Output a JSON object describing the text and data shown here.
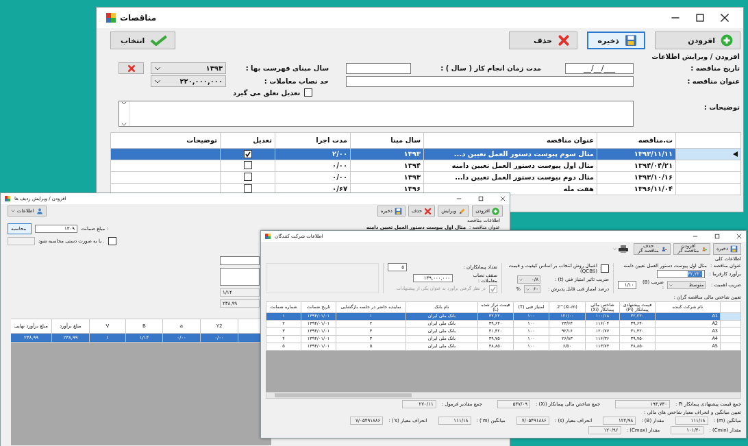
{
  "main_window": {
    "title": "مناقصات",
    "toolbar": [
      {
        "label": "افزودن",
        "focused": false
      },
      {
        "label": "ذخیره",
        "focused": true
      },
      {
        "label": "حذف",
        "focused": false
      }
    ],
    "select_button": {
      "label": "انتخاب"
    },
    "form": {
      "title": "افزودن / ویرایش اطلاعات",
      "date_label": "تاریخ مناقصه :",
      "date_value": "___/__/__",
      "duration_label": "مدت زمان انجام کار ( سال ) :",
      "base_year_label": "سال مبنای فهرست بها :",
      "base_year": "۱۳۹۳",
      "title_label": "عنوان مناقصه :",
      "threshold_label": "حد نصاب معاملات :",
      "threshold": "۲۲۰,۰۰۰,۰۰۰",
      "adjustment": {
        "label": "تعدیل تعلق می گیرد",
        "checked": false
      },
      "notes_label": "توضیحات :"
    },
    "table": {
      "columns": [
        "ت.مناقصه",
        "عنوان مناقصه",
        "سال مبنا",
        "مدت اجرا",
        "تعدیل",
        "توضیحات"
      ],
      "rows": [
        {
          "date": "۱۳۹۳/۱۱/۱۱",
          "title": "مثال سوم پیوست دستور العمل تعیین د...",
          "year": "۱۳۹۳",
          "duration": "۲/۰۰",
          "adjusted": true,
          "selected": true
        },
        {
          "date": "۱۳۹۴/۰۴/۲۱",
          "title": "مثال اول پیوست دستور العمل تعیین دامنه",
          "year": "۱۳۹۴",
          "duration": "۰/۰۰",
          "adjusted": false,
          "selected": false
        },
        {
          "date": "۱۳۹۳/۱۰/۱۶",
          "title": "مثال دوم پیوست دستور العمل تعیین دا...",
          "year": "۱۳۹۳",
          "duration": "۰/۰۰",
          "adjusted": false,
          "selected": false
        },
        {
          "date": "۱۳۹۶/۱۱/۰۴",
          "title": "هفت مله",
          "year": "۱۳۹۶",
          "duration": "۰/۶۷",
          "adjusted": false,
          "selected": false
        }
      ]
    }
  },
  "rows_window": {
    "title": "افزودن / ویرایش ردیف ها",
    "info_button": "اطلاعات",
    "toolbar": [
      {
        "label": "افزودن"
      },
      {
        "label": "ویرایش"
      },
      {
        "label": "حذف"
      },
      {
        "label": "ذخیره"
      }
    ],
    "tender_info": {
      "title": "اطلاعات مناقصه",
      "label": "عنوان مناقصه :",
      "value": "مثال اول پیوست دستور العمل تعیین دامنه"
    },
    "guarantee_label": "مبلغ ضمانت :",
    "guarantee_value": "۱۳۰۹",
    "calc_button": "محاسبه",
    "manual": {
      "label": "یا به صورت دستی محاسبه شود .",
      "checked": false
    },
    "readouts": [
      "۱/۱۴",
      "۲۳۸,۹۹"
    ],
    "table": {
      "columns": [
        "Y2",
        "a",
        "B",
        "V",
        "مبلغ برآورد",
        "مبلغ برآورد نهایی"
      ],
      "rows": [
        {
          "cells": [
            "۰/۰۰",
            "۰/۰۰",
            "۱/۱۴",
            "۱",
            "۲۳۸,۹۹",
            "۲۳۸,۹۹"
          ],
          "selected": true
        }
      ]
    }
  },
  "bidders_window": {
    "title": "اطلاعات شرکت کنندگان",
    "toolbar": [
      {
        "label": "ذخیره"
      },
      {
        "label": "افزودن مناقصه گر"
      },
      {
        "label": "حذف مناقصه گر"
      }
    ],
    "general": {
      "title": "اطلاعات کلی",
      "tender_label": "عنوان مناقصه :",
      "tender_value": "مثال اول پیوست دستور العمل تعیین دامنه",
      "estimate_label": "برآورد کارفرما :",
      "estimate_value": "۳۲,۲۲۰",
      "importance_label": "ضریب اهمیت :",
      "importance": "متوسط",
      "b_label": "ضریب (B) :",
      "b_value": "۱/۱۰",
      "qcbs": {
        "label": "اعمال روش انتخاب بر اساس کیفیت و قیمت (QCBS)",
        "checked": false
      },
      "t_label": "ضریب تاثیر امتیاز فنی (t) :",
      "t_value": "۰/۸",
      "pass_label": "درصد امتیاز فنی قابل پذیرش :",
      "pass_value": "۶۰",
      "percent": "%",
      "count_label": "تعداد پیمانکاران :",
      "count": "۵",
      "cap_label": "سقف نصاب معاملات :",
      "cap": "۱۳۹,۰۰۰,۰۰۰",
      "include_estimate": {
        "label": "در نظر گرفتن برآورد به عنوان یکی از پیشنهادات",
        "checked": true,
        "disabled": true
      }
    },
    "table_title": "تعیین شاخص مالی مناقصه گران :",
    "table": {
      "columns": [
        "نام شرکت کننده",
        "قیمت پیشنهادی پیمانکار (Pi)",
        "شاخص مالی پیمانکار (Xi)",
        "(Xi-m)^2",
        "امتیاز فنی (T)",
        "قیمت تراز شده (L)",
        "نام بانک",
        "نماینده حاضر در جلسه بازگشایی",
        "تاریخ ضمانت",
        "شماره ضمانت"
      ],
      "rows": [
        {
          "cells": [
            "A1",
            "۳۲,۲۲۰",
            "۱۰۰/۱۸",
            "۱۲۱/۰۰",
            "۱۰۰",
            "۳۲,۲۲۰",
            "بانک ملی ایران",
            "۱",
            "۱۳۹۴/۰۱/۰۱",
            "۱"
          ],
          "selected": true
        },
        {
          "cells": [
            "A2",
            "۳۹,۶۴۰",
            "۱۱۶/۰۴",
            "۲۳/۶۴",
            "۱۰۰",
            "۳۹,۶۴۰",
            "بانک ملی ایران",
            "۲",
            "۱۳۹۴/۰۱/۰۱",
            "۲"
          ],
          "selected": false
        },
        {
          "cells": [
            "A3",
            "۳۱,۴۲۰",
            "۱۲۰/۷۷",
            "۹۲/۱۶",
            "۱۰۰",
            "۳۱,۴۲۰",
            "بانک ملی ایران",
            "۳",
            "۱۳۹۴/۰۱/۰۱",
            "۳"
          ],
          "selected": false
        },
        {
          "cells": [
            "A4",
            "۳۹,۷۵۰",
            "۱۱۶/۳۶",
            "۲۶/۸۳",
            "۱۰۰",
            "۳۹,۷۵۰",
            "بانک ملی ایران",
            "۳",
            "۱۳۹۴/۰۱/۰۱",
            "۴"
          ],
          "selected": false
        },
        {
          "cells": [
            "A5",
            "۳۸,۸۵۰",
            "۱۱۳/۷۴",
            "۶/۵۰",
            "۱۰۰",
            "۳۸,۸۵۰",
            "بانک ملی ایران",
            "۵",
            "۱۳۹۴/۰۱/۰۱",
            "۵"
          ],
          "selected": false
        }
      ]
    },
    "sums": [
      {
        "label": "جمع قیمت پیشنهادی پیمانکار Pi :",
        "value": "۱۹۳,۷۳۰"
      },
      {
        "label": "جمع شاخص مالی پیمانکار (Xi) :",
        "value": "۵۴۷/۰۹"
      },
      {
        "label": "جمع مقادیر فرمول :",
        "value": "۲۷۰/۱۱"
      }
    ],
    "stats_title": "تعیین میانگین و انحراف معیار شاخص های مالی :",
    "stats": [
      [
        {
          "label": "میانگین (m) :",
          "value": "۱۱۱/۱۸"
        },
        {
          "label": "مقدار (B) :",
          "value": "۱۲۲/۹۸"
        },
        {
          "label": "انحراف معیار (s) :",
          "value": "۷/۰۵۴۹۱۸۸۶"
        },
        {
          "label": "میانگین (m') :",
          "value": "۱۱۱/۱۸"
        },
        {
          "label": "انحراف معیار (s') :",
          "value": "۷/۰۵۴۹۱۸۸۶"
        }
      ],
      [
        {
          "label": "مقدار (Cmin) :",
          "value": "۱۰۱/۴۰"
        },
        {
          "label": "مقدار (Cmax) :",
          "value": "۱۲۰/۹۶"
        }
      ]
    ]
  }
}
